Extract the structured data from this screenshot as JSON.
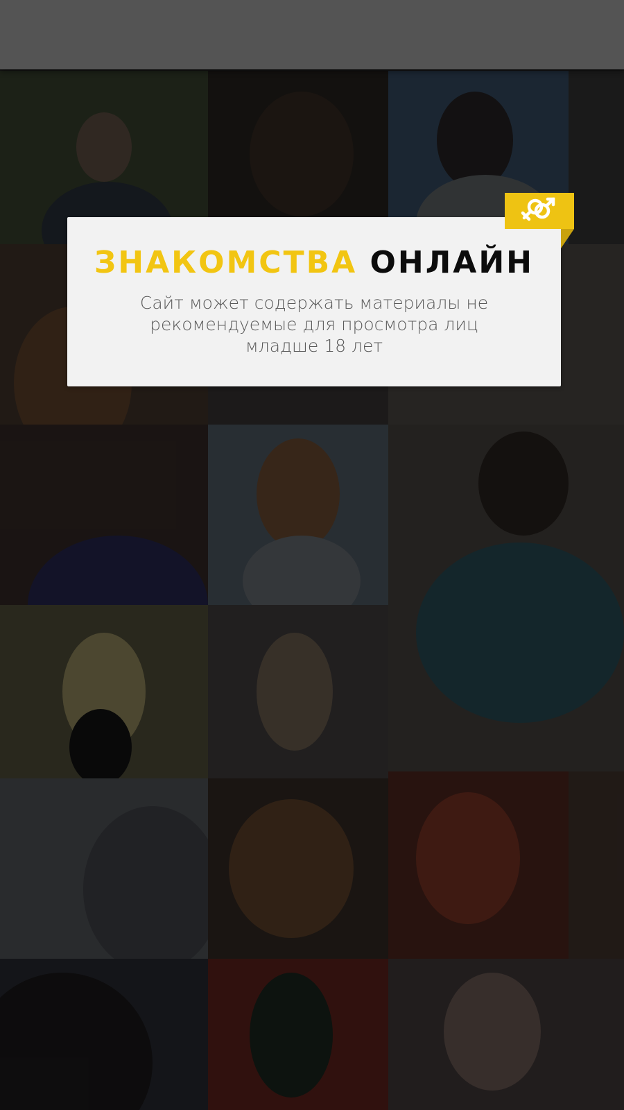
{
  "dialog": {
    "title_accent": "ЗНАКОМСТВА",
    "title_main": "ОНЛАЙН",
    "warning_text": "Сайт может содержать материалы не рекомендуемые для просмотра лиц младше 18 лет",
    "badge_icon": "gender-symbols-icon"
  },
  "colors": {
    "accent": "#f2c512",
    "title_dark": "#0c0c0c",
    "dialog_bg": "#f2f2f2",
    "top_bar": "#545454"
  }
}
